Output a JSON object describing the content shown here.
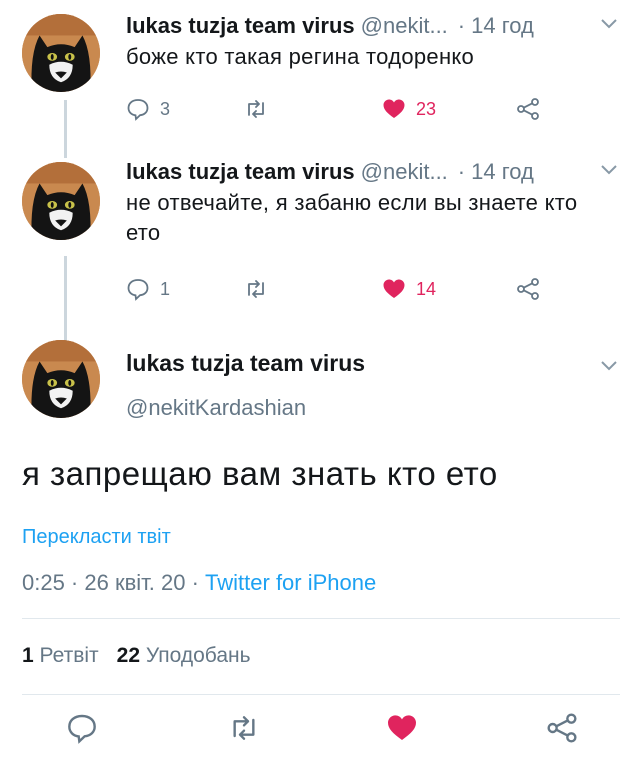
{
  "colors": {
    "accent": "#1da1f2",
    "like": "#e0245e",
    "secondary_text": "#657786",
    "primary_text": "#14171a"
  },
  "replies": [
    {
      "name": "lukas tuzja team virus",
      "handle": "@nekit...",
      "separator": "·",
      "time": "14 год",
      "text": "боже кто такая регина тодоренко",
      "reply_count": "3",
      "like_count": "23",
      "liked": true
    },
    {
      "name": "lukas tuzja team virus",
      "handle": "@nekit...",
      "separator": "·",
      "time": "14 год",
      "text": "не отвечайте, я забаню если вы знаете кто ето",
      "reply_count": "1",
      "like_count": "14",
      "liked": true
    }
  ],
  "main_tweet": {
    "name": "lukas tuzja team virus",
    "handle": "@nekitKardashian",
    "text": "я запрещаю вам знать кто ето",
    "translate_label": "Перекласти твіт",
    "time_date": "0:25 · 26 квіт. 20 · ",
    "source": "Twitter for iPhone",
    "retweet_count": "1",
    "retweet_label": "Ретвіт",
    "like_count": "22",
    "like_label": "Уподобань"
  },
  "icons": {
    "reply": "reply-icon",
    "retweet": "retweet-icon",
    "like": "heart-icon",
    "share": "share-icon",
    "caret": "chevron-down-icon"
  }
}
